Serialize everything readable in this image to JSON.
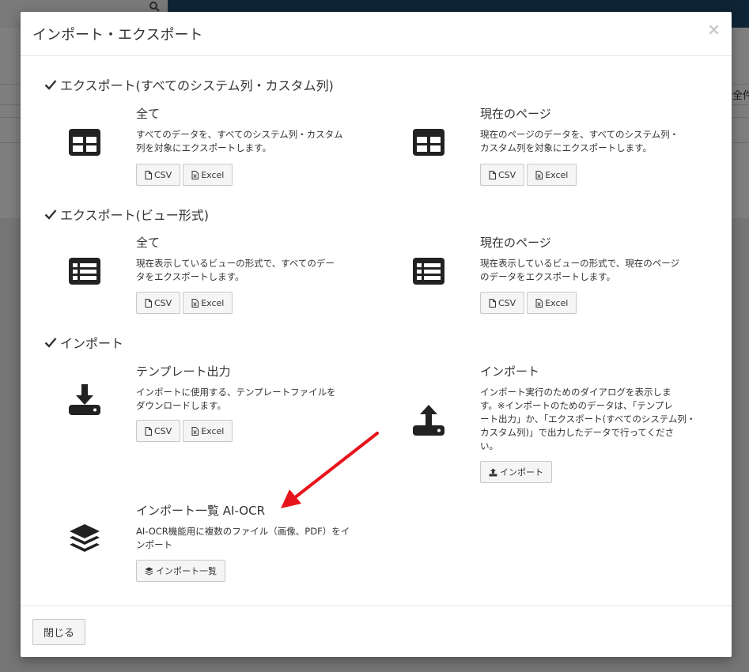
{
  "background": {
    "side_text": "全件"
  },
  "modal": {
    "title": "インポート・エクスポート",
    "close_symbol": "×",
    "footer_close_label": "閉じる"
  },
  "sections": [
    {
      "title": "エクスポート(すべてのシステム列・カスタム列)"
    },
    {
      "title": "エクスポート(ビュー形式)"
    },
    {
      "title": "インポート"
    }
  ],
  "items": {
    "export_all_all": {
      "title": "全て",
      "desc_lines": [
        "すべてのデータを、すべてのシステム列・カスタム",
        "列を対象にエクスポートします。"
      ],
      "icon": "table-icon",
      "buttons": [
        "CSV",
        "Excel"
      ]
    },
    "export_all_page": {
      "title": "現在のページ",
      "desc_lines": [
        "現在のページのデータを、すべてのシステム列・",
        "カスタム列を対象にエクスポートします。"
      ],
      "icon": "table-icon",
      "buttons": [
        "CSV",
        "Excel"
      ]
    },
    "export_view_all": {
      "title": "全て",
      "desc_lines": [
        "現在表示しているビューの形式で、すべてのデー",
        "タをエクスポートします。"
      ],
      "icon": "list-icon",
      "buttons": [
        "CSV",
        "Excel"
      ]
    },
    "export_view_page": {
      "title": "現在のページ",
      "desc_lines": [
        "現在表示しているビューの形式で、現在のページ",
        "のデータをエクスポートします。"
      ],
      "icon": "list-icon",
      "buttons": [
        "CSV",
        "Excel"
      ]
    },
    "template": {
      "title": "テンプレート出力",
      "desc_lines": [
        "インポートに使用する、テンプレートファイルを",
        "ダウンロードします。"
      ],
      "icon": "download-icon",
      "buttons": [
        "CSV",
        "Excel"
      ]
    },
    "import": {
      "title": "インポート",
      "desc_lines": [
        "インポート実行のためのダイアログを表示しま",
        "す。※インポートのためのデータは、「テンプレ",
        "ート出力」か、「エクスポート(すべてのシステム列・",
        "カスタム列)」で出力したデータで行ってくださ",
        "い。"
      ],
      "icon": "upload-icon",
      "button": "インポート"
    },
    "import_list": {
      "title": "インポート一覧 AI-OCR",
      "desc_lines": [
        "AI-OCR機能用に複数のファイル（画像、PDF）をイ",
        "ンポート"
      ],
      "icon": "layers-icon",
      "button": "インポート一覧"
    }
  },
  "colors": {
    "annotation_arrow": "#e8141b",
    "header_bar": "#1d4a6e"
  }
}
